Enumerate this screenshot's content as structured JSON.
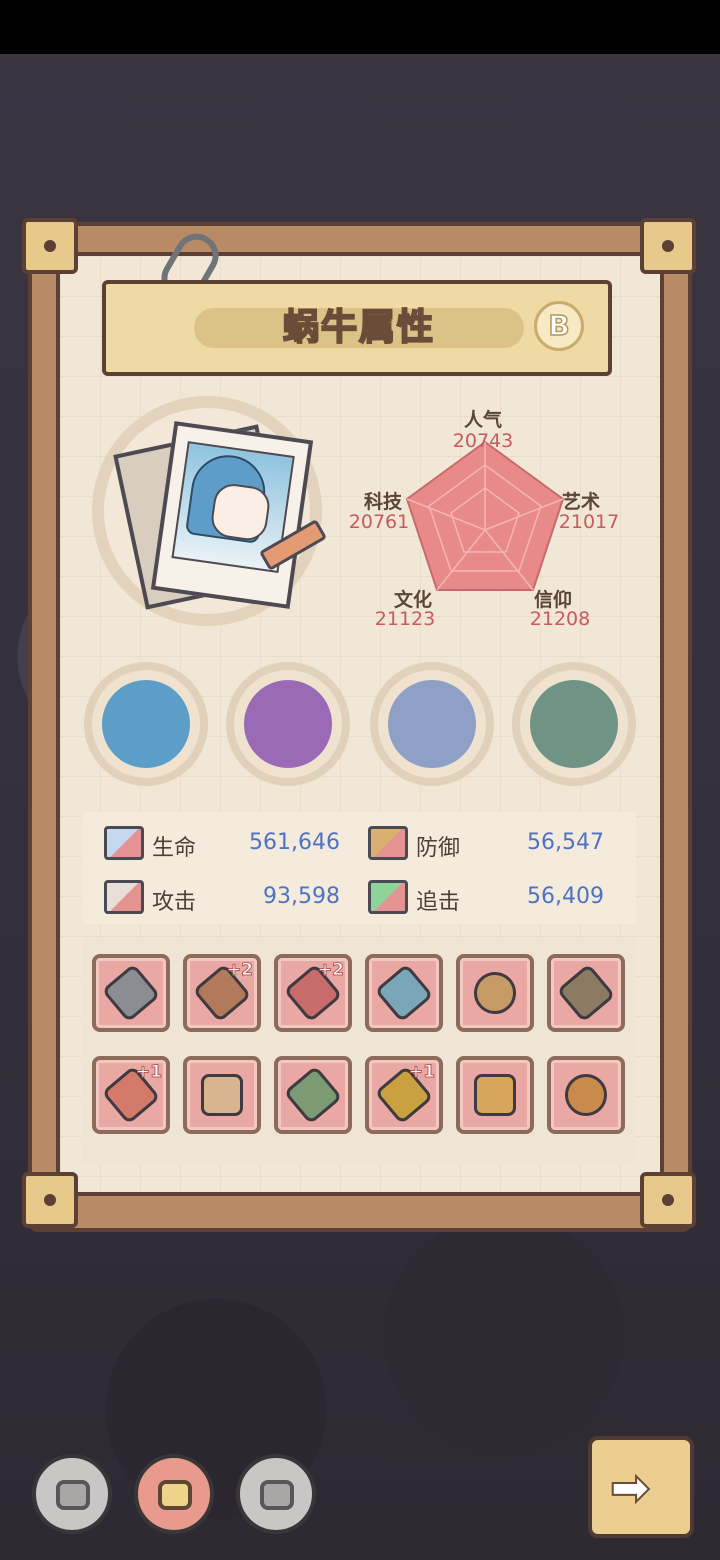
{
  "title": "蜗牛属性",
  "grade": "B",
  "radar": {
    "stats": [
      {
        "name": "人气",
        "value": "20743"
      },
      {
        "name": "艺术",
        "value": "21017"
      },
      {
        "name": "信仰",
        "value": "21208"
      },
      {
        "name": "文化",
        "value": "21123"
      },
      {
        "name": "科技",
        "value": "20761"
      }
    ]
  },
  "attributes": [
    {
      "icon": "chaos-orb-icon",
      "color": "#5c9ec8"
    },
    {
      "icon": "heart-shell-icon",
      "color": "#9a6ab6"
    },
    {
      "icon": "compass-icon",
      "color": "#8fa0c7"
    },
    {
      "icon": "buddha-statue-icon",
      "color": "#6f9486"
    }
  ],
  "combat": [
    {
      "label": "生命",
      "value": "561,646",
      "icon": "life-icon"
    },
    {
      "label": "防御",
      "value": "56,547",
      "icon": "defense-icon"
    },
    {
      "label": "攻击",
      "value": "93,598",
      "icon": "attack-icon"
    },
    {
      "label": "追击",
      "value": "56,409",
      "icon": "pursuit-icon"
    }
  ],
  "equipment": [
    {
      "icon": "helmet-icon",
      "plus": "",
      "color": "#8b8d93"
    },
    {
      "icon": "dagger-icon",
      "plus": "+2",
      "color": "#b27a5a"
    },
    {
      "icon": "curved-blade-icon",
      "plus": "+2",
      "color": "#c76b6b"
    },
    {
      "icon": "sword-icon",
      "plus": "",
      "color": "#7aa6b8"
    },
    {
      "icon": "ring-icon",
      "plus": "",
      "color": "#c79b66"
    },
    {
      "icon": "ornament-icon",
      "plus": "",
      "color": "#8c7a62"
    },
    {
      "icon": "staff-icon",
      "plus": "+1",
      "color": "#d47a6a"
    },
    {
      "icon": "cloak-icon",
      "plus": "",
      "color": "#d8b58f"
    },
    {
      "icon": "hammer-icon",
      "plus": "",
      "color": "#7c9a74"
    },
    {
      "icon": "serpent-scepter-icon",
      "plus": "+1",
      "color": "#c9a23f"
    },
    {
      "icon": "winged-armor-icon",
      "plus": "",
      "color": "#d7a65a"
    },
    {
      "icon": "jeweled-amulet-icon",
      "plus": "",
      "color": "#c98a4a"
    }
  ],
  "bottom_nav": [
    {
      "icon": "snail-face-icon",
      "state": "inactive"
    },
    {
      "icon": "snail-card-icon",
      "state": "active"
    },
    {
      "icon": "snail-brain-icon",
      "state": "inactive"
    }
  ],
  "next_button": {
    "icon": "arrow-right-icon",
    "glyph": "➡"
  }
}
